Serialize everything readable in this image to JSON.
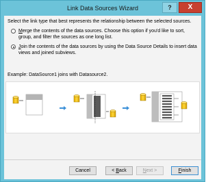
{
  "window": {
    "title": "Link Data Sources Wizard",
    "help_label": "?",
    "close_label": "X"
  },
  "prompt": "Select the link type that best represents the relationship between the selected sources.",
  "options": [
    {
      "selected": false,
      "mnemonic": "M",
      "line1_rest": "erge the contents of the data sources. Choose this option if you'd like to sort,",
      "line2": "group, and filter the sources as one long list."
    },
    {
      "selected": true,
      "mnemonic": "J",
      "line1_rest": "oin the contents of the data sources by using the Data Source Details to insert data",
      "line2": "views and joined subviews."
    }
  ],
  "example": "Example: DataSource1 joins with Datasource2.",
  "buttons": {
    "cancel": "Cancel",
    "back_prefix": "< ",
    "back_mnemonic": "B",
    "back_rest": "ack",
    "next_mnemonic": "N",
    "next_rest": "ext >",
    "finish_mnemonic": "F",
    "finish_rest": "inish"
  },
  "colors": {
    "frame": "#6cc3d9",
    "close": "#c7402f",
    "cylinder": "#f2c200",
    "arrow": "#3a8fd8"
  }
}
